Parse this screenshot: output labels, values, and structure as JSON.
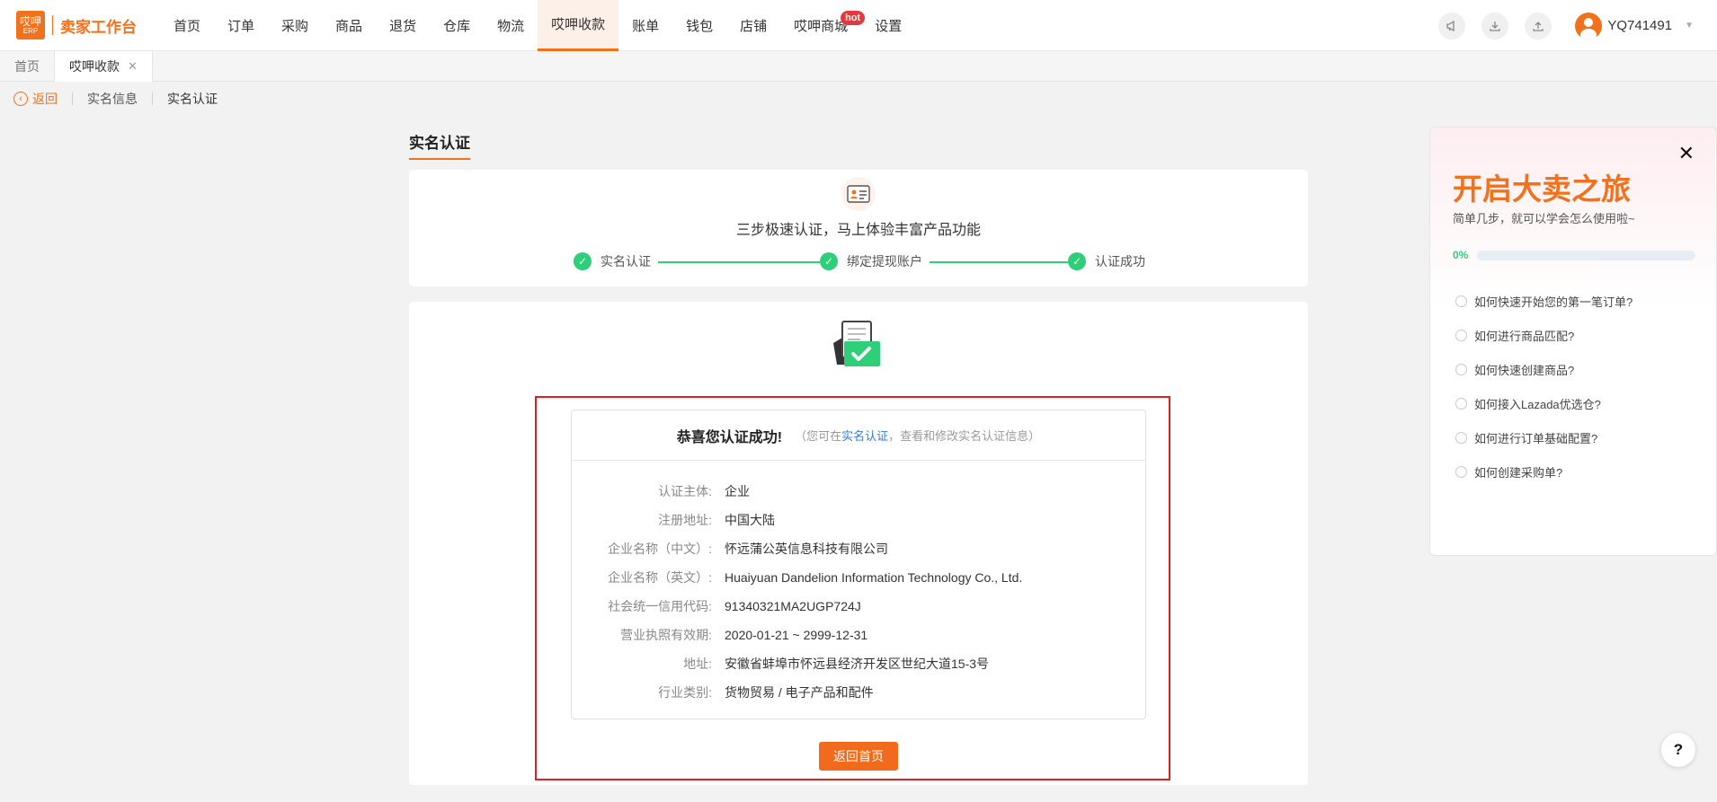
{
  "header": {
    "logo_main": "哎呷",
    "logo_sub": "ERP",
    "app_title": "卖家工作台",
    "nav": [
      {
        "label": "首页"
      },
      {
        "label": "订单"
      },
      {
        "label": "采购"
      },
      {
        "label": "商品"
      },
      {
        "label": "退货"
      },
      {
        "label": "仓库"
      },
      {
        "label": "物流"
      },
      {
        "label": "哎呷收款",
        "active": true
      },
      {
        "label": "账单"
      },
      {
        "label": "钱包"
      },
      {
        "label": "店铺"
      },
      {
        "label": "哎呷商城",
        "badge": "hot"
      },
      {
        "label": "设置"
      }
    ],
    "icons": [
      "megaphone-icon",
      "download-icon",
      "upload-icon"
    ],
    "username": "YQ741491"
  },
  "tabs": [
    {
      "label": "首页"
    },
    {
      "label": "哎呷收款",
      "active": true,
      "closable": true
    }
  ],
  "breadcrumb": {
    "back": "返回",
    "items": [
      "实名信息",
      "实名认证"
    ]
  },
  "page_title": "实名认证",
  "steps": {
    "caption": "三步极速认证，马上体验丰富产品功能",
    "items": [
      {
        "label": "实名认证",
        "done": true
      },
      {
        "label": "绑定提现账户",
        "done": true
      },
      {
        "label": "认证成功",
        "done": true
      }
    ]
  },
  "result": {
    "title": "恭喜您认证成功!",
    "note_prefix": "（您可在",
    "note_link": "实名认证",
    "note_suffix": "，查看和修改实名认证信息）",
    "rows": [
      {
        "label": "认证主体:",
        "value": "企业"
      },
      {
        "label": "注册地址:",
        "value": "中国大陆"
      },
      {
        "label": "企业名称（中文）:",
        "value": "怀远蒲公英信息科技有限公司"
      },
      {
        "label": "企业名称（英文）:",
        "value": "Huaiyuan Dandelion Information Technology Co., Ltd."
      },
      {
        "label": "社会统一信用代码:",
        "value": "91340321MA2UGP724J"
      },
      {
        "label": "营业执照有效期:",
        "value": "2020-01-21 ~ 2999-12-31"
      },
      {
        "label": "地址:",
        "value": "安徽省蚌埠市怀远县经济开发区世纪大道15-3号"
      },
      {
        "label": "行业类别:",
        "value": "货物贸易 / 电子产品和配件"
      }
    ],
    "home_button": "返回首页"
  },
  "guide": {
    "title": "开启大卖之旅",
    "subtitle": "简单几步，就可以学会怎么使用啦~",
    "progress_label": "0%",
    "progress": 0,
    "items": [
      "如何快速开始您的第一笔订单?",
      "如何进行商品匹配?",
      "如何快速创建商品?",
      "如何接入Lazada优选仓?",
      "如何进行订单基础配置?",
      "如何创建采购单?"
    ]
  },
  "help": "?",
  "colors": {
    "accent": "#f2711c",
    "success": "#2fcf7a",
    "highlight": "#e02020",
    "link": "#2f7de1"
  }
}
